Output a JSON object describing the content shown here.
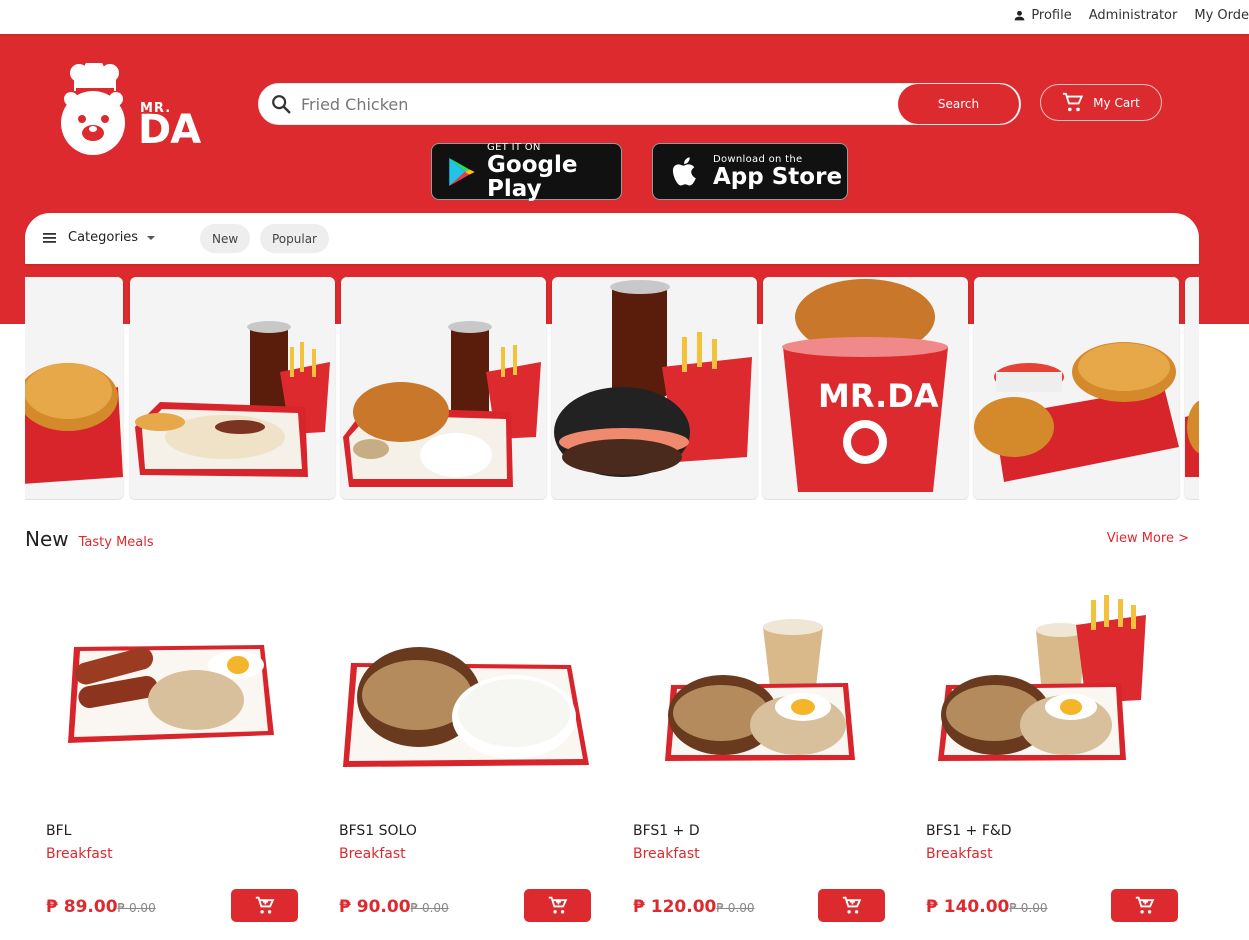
{
  "top_nav": {
    "profile": "Profile",
    "admin": "Administrator",
    "orders": "My Orde"
  },
  "brand": {
    "small": "MR.",
    "big": "DA"
  },
  "search": {
    "placeholder": "Fried Chicken",
    "button": "Search"
  },
  "cart": {
    "label": "My Cart"
  },
  "stores": {
    "google": {
      "line1": "GET IT ON",
      "line2": "Google Play"
    },
    "apple": {
      "line1": "Download on the",
      "line2": "App Store"
    }
  },
  "categories": {
    "label": "Categories",
    "chips": [
      "New",
      "Popular"
    ]
  },
  "section": {
    "title": "New",
    "subtitle": "Tasty Meals",
    "more": "View More >"
  },
  "products": [
    {
      "name": "BFL",
      "category": "Breakfast",
      "price": "₱ 89.00",
      "old_price": "₱ 0.00"
    },
    {
      "name": "BFS1 SOLO",
      "category": "Breakfast",
      "price": "₱ 90.00",
      "old_price": "₱ 0.00"
    },
    {
      "name": "BFS1 +  D",
      "category": "Breakfast",
      "price": "₱ 120.00",
      "old_price": "₱ 0.00"
    },
    {
      "name": "BFS1 + F&D",
      "category": "Breakfast",
      "price": "₱ 140.00",
      "old_price": "₱ 0.00"
    }
  ],
  "colors": {
    "brand_red": "#dd2a2f"
  }
}
